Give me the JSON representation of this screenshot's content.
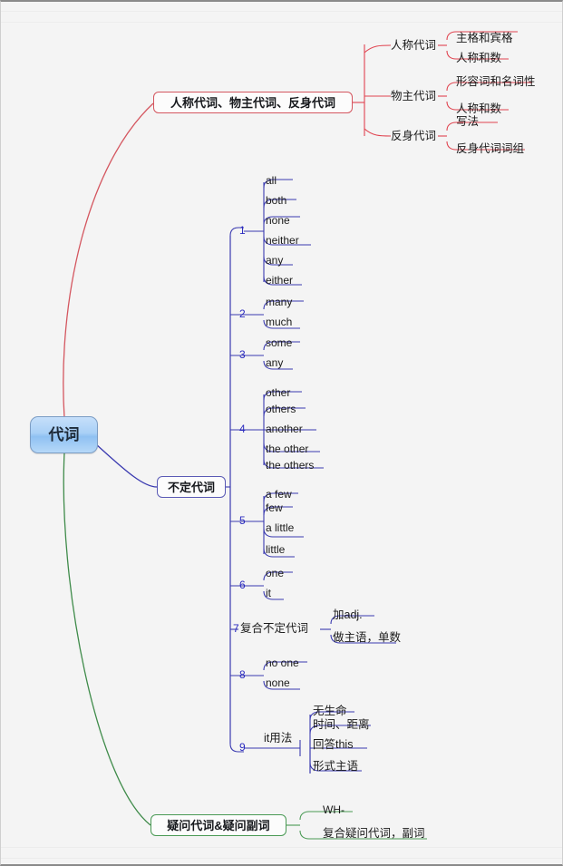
{
  "meta": {
    "title": "代词 mind map",
    "colors": {
      "root_border": "#7c9dc4",
      "root_fill": "#a9d0f6",
      "red_branch": "#d4565f",
      "blue_branch": "#3a3ab0",
      "green_branch": "#3f8b4a",
      "background": "#f4f4f4"
    }
  },
  "root": {
    "label": "代词"
  },
  "branches": [
    {
      "id": "personal",
      "label": "人称代词、物主代词、反身代词",
      "color": "#d4565f",
      "children": [
        {
          "label": "人称代词",
          "leaves": [
            "主格和宾格",
            "人称和数"
          ]
        },
        {
          "label": "物主代词",
          "leaves": [
            "形容词和名词性",
            "人称和数"
          ]
        },
        {
          "label": "反身代词",
          "leaves": [
            "写法",
            "反身代词词组"
          ]
        }
      ]
    },
    {
      "id": "indefinite",
      "label": "不定代词",
      "color": "#3a3ab0",
      "groups": [
        {
          "num": "1",
          "label": "",
          "leaves": [
            "all",
            "both",
            "none",
            "neither",
            "any",
            "either"
          ]
        },
        {
          "num": "2",
          "label": "",
          "leaves": [
            "many",
            "much"
          ]
        },
        {
          "num": "3",
          "label": "",
          "leaves": [
            "some",
            "any"
          ]
        },
        {
          "num": "4",
          "label": "",
          "leaves": [
            "other",
            "others",
            "another",
            "the other",
            "the others"
          ]
        },
        {
          "num": "5",
          "label": "",
          "leaves": [
            "a few",
            "few",
            "a little",
            "little"
          ]
        },
        {
          "num": "6",
          "label": "",
          "leaves": [
            "one",
            "it"
          ]
        },
        {
          "num": "7",
          "label": "复合不定代词",
          "leaves": [
            "加adj.",
            "做主语，单数"
          ]
        },
        {
          "num": "8",
          "label": "",
          "leaves": [
            "no one",
            "none"
          ]
        },
        {
          "num": "9",
          "label": "it用法",
          "leaves": [
            "无生命",
            "时间、距离",
            "回答this",
            "形式主语"
          ]
        }
      ]
    },
    {
      "id": "interrogative",
      "label": "疑问代词&疑问副词",
      "color": "#3f8b4a",
      "leaves": [
        "WH-",
        "复合疑问代词，副词"
      ]
    }
  ]
}
